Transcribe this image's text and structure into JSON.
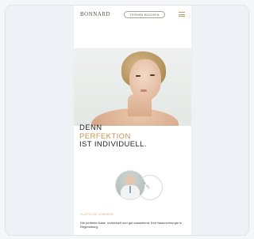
{
  "header": {
    "brand": "BONNARD",
    "cta_label": "TERMIN BUCHEN",
    "menu_icon": "hamburger-menu-icon"
  },
  "hero": {
    "image_desc": "portrait"
  },
  "headline": {
    "line1": "DENN",
    "line2": "PERFEKTION",
    "line3": "IST INDIVIDUELL."
  },
  "badge": {
    "ring_text": "DR. MED.",
    "subline": "PLASTISCHE CHIRURGIE"
  },
  "body": {
    "text": "Die perfekte Nase, individuell und gut aussehend. Ihre Nasenchirurgie in Regensburg."
  },
  "colors": {
    "accent": "#c8944e",
    "text": "#2a2623",
    "frame": "#eef1f6"
  }
}
